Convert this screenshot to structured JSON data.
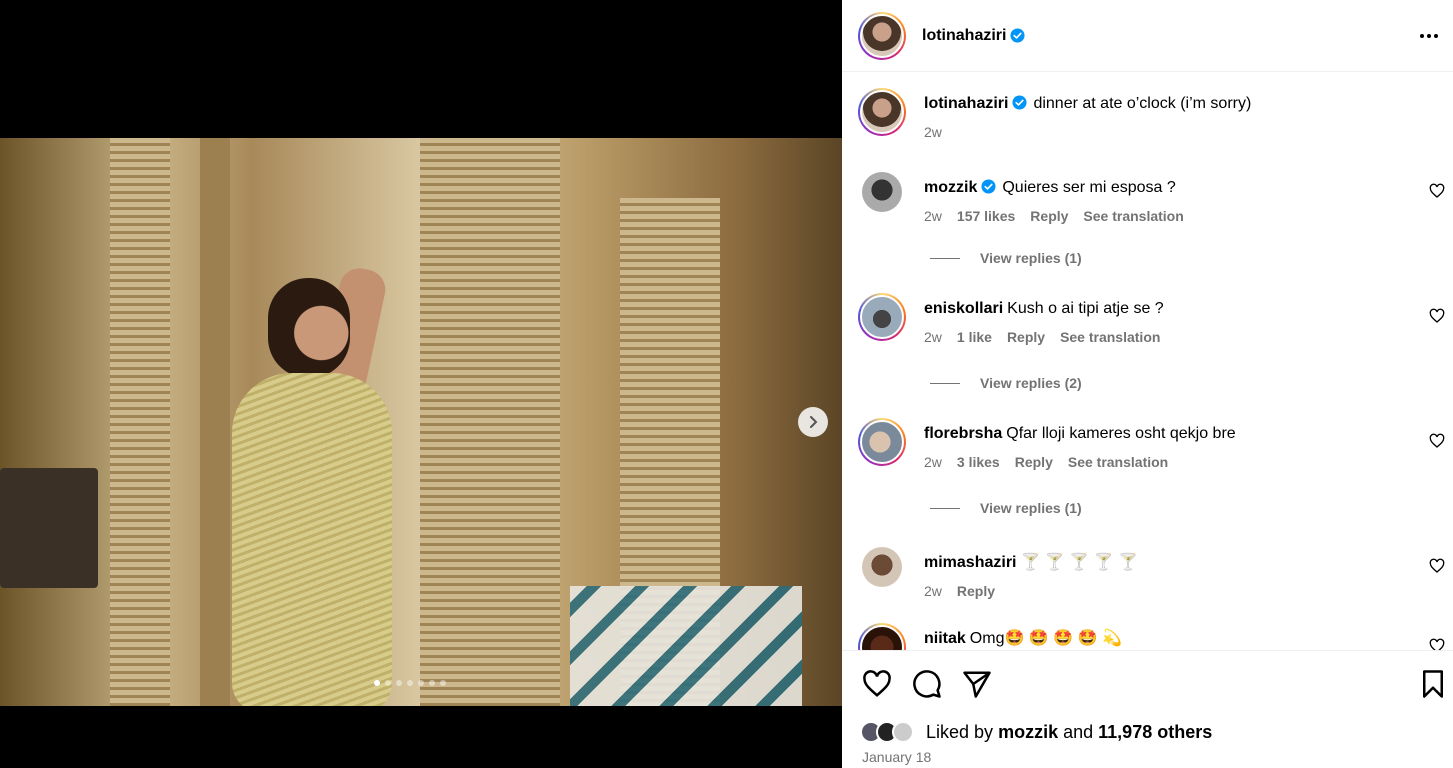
{
  "post": {
    "author": "lotinahaziri",
    "caption": "dinner at ate o’clock (i’m sorry)",
    "caption_age": "2w",
    "slides_count": 7,
    "active_slide": 1
  },
  "comments": [
    {
      "user": "mozzik",
      "verified": true,
      "text": "Quieres ser mi esposa ?",
      "age": "2w",
      "likes": "157 likes",
      "reply": "Reply",
      "translate": "See translation",
      "view_replies": "View replies (1)"
    },
    {
      "user": "eniskollari",
      "verified": false,
      "text": "Kush o ai tipi atje se ?",
      "age": "2w",
      "likes": "1 like",
      "reply": "Reply",
      "translate": "See translation",
      "view_replies": "View replies (2)"
    },
    {
      "user": "florebrsha",
      "verified": false,
      "text": "Qfar lloji kameres osht qekjo bre",
      "age": "2w",
      "likes": "3 likes",
      "reply": "Reply",
      "translate": "See translation",
      "view_replies": "View replies (1)"
    },
    {
      "user": "mimashaziri",
      "verified": false,
      "text": "🍸 🍸 🍸 🍸 🍸",
      "age": "2w",
      "reply": "Reply"
    },
    {
      "user": "niitak",
      "verified": false,
      "text": "Omg🤩 🤩 🤩 🤩 💫"
    }
  ],
  "likes": {
    "prefix": "Liked by",
    "user": "mozzik",
    "and": "and",
    "count": "11,978 others"
  },
  "date": "January 18",
  "icons": {
    "heart": "heart-icon",
    "comment": "comment-icon",
    "share": "share-icon",
    "save": "bookmark-icon",
    "more": "more-icon",
    "next": "chevron-right-icon"
  }
}
